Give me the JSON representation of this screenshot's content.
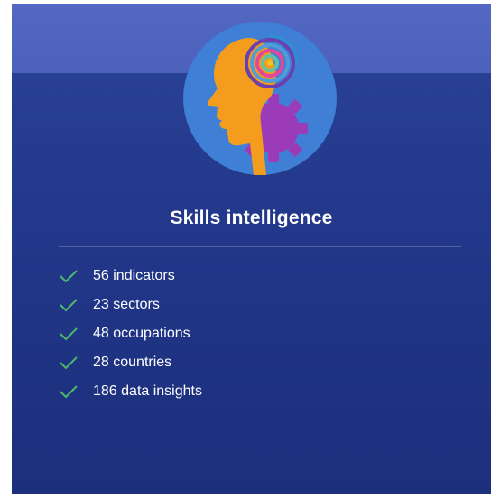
{
  "card": {
    "title": "Skills intelligence",
    "icon": "ai-head-target-gear-icon",
    "features": [
      {
        "label": "56 indicators",
        "icon": "check-icon"
      },
      {
        "label": "23 sectors",
        "icon": "check-icon"
      },
      {
        "label": "48 occupations",
        "icon": "check-icon"
      },
      {
        "label": "28 countries",
        "icon": "check-icon"
      },
      {
        "label": "186 data insights",
        "icon": "check-icon"
      }
    ]
  },
  "colors": {
    "card_background": "#243a8d",
    "top_band": "#4f64bf",
    "emblem_circle": "#3f7fd6",
    "head": "#f39c1e",
    "gear": "#9b3bb8",
    "check": "#4cb86b",
    "text": "#ffffff"
  }
}
